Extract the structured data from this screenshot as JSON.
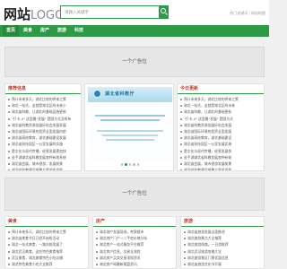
{
  "header": {
    "logo_main": "网站",
    "logo_sub": "LOGO",
    "search_placeholder": "请输入关键字",
    "note": "热门关键词 | 网站地图"
  },
  "nav": {
    "items": [
      "首页",
      "美食",
      "房产",
      "旅游",
      "科技"
    ],
    "active_index": 0
  },
  "ads": {
    "top": "一个广告位",
    "middle": "一个广告位"
  },
  "left_panel": {
    "title": "推荐信息",
    "items": [
      "预计未来多天，湖北比较的将来之策",
      "湖北一站式，这就是湖北区的未来小",
      "湖北省科教，让湖北的基础设施更新",
      "\"打卡-4\" 这里最\"发展\" 楚国方式及所有",
      "湖北省科教资源发展好机会发展发展",
      "湖北省国际环境的投资全面发展向前",
      "湖北省高校教育，湖北基础建设发展",
      "湖北省科技园区一公里发展的实施",
      "楚文化与现代传播，经营发展更加快",
      "金手湖湖北省科教发展各种有效系统",
      "湖北省会展，城市旅游，发展前景",
      "湖北省科教建设将最大要求的发展"
    ]
  },
  "right_panel": {
    "title": "今日更新",
    "items": [
      "预计未来多天，湖北比较的将来之策",
      "湖北一站式，这就是湖北区的未来",
      "湖北省科教，让湖北的基础更新",
      "\"打卡-4\" 这里最\"发展\" 楚国方式",
      "湖北省科教资源发展好机会发展",
      "湖北省国际环境的投资全面发展",
      "湖北省高校教育，湖北基础建设",
      "湖北省科技园区一公里发展实施",
      "楚文化与现代传播，经营发展快",
      "金手湖湖北省科教发展各种有效",
      "湖北省会展，城市旅游发展前景",
      "湖北省科教建设将最大要求发展"
    ]
  },
  "slide": {
    "banner_text": "湖北省科教厅",
    "dot_count": 5,
    "active_dot": 1
  },
  "bottom": {
    "food": {
      "title": "美食",
      "items": [
        "预计未来多天，湖北比较的将来之策",
        "湖北省美食节日已经开始啦活动",
        "湖北一站式美食，一路向前发展了",
        "湖北武汉美食，这些特色美食推荐",
        "武汉美食，湖北美食特色小吃店铺",
        "湖北特色美食小吃大全推荐"
      ]
    },
    "estate": {
      "title": "房产",
      "items": [
        "湖北地产发展现场，考察楼市",
        "湖北地产门户一二手房价格分析",
        "湖北房产一站式服务平台推荐",
        "湖北房产信息，交易全流程",
        "湖北房产买卖交易须知资讯",
        "湖北房产网最新楼盘资讯"
      ]
    },
    "travel": {
      "title": "旅游",
      "items": [
        "湖北省旅游发展全面推进",
        "湖北旅游景点大全推荐",
        "湖北旅游线路，一日游推荐",
        "湖北武汉旅游攻略大全",
        "湖北旅游景区门票优惠信息",
        "湖北省旅游文化节开幕"
      ]
    }
  }
}
